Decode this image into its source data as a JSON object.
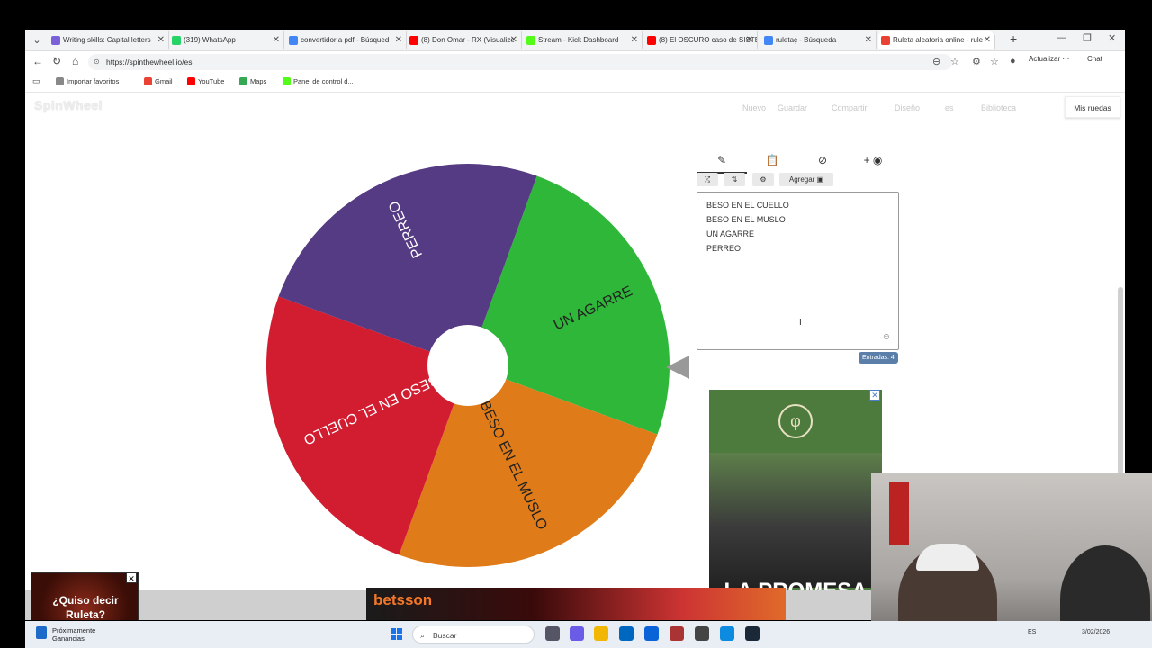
{
  "browser": {
    "tabs": [
      {
        "label": "Writing skills: Capital letters",
        "color": "#7b61d9"
      },
      {
        "label": "(319) WhatsApp",
        "color": "#25d366"
      },
      {
        "label": "convertidor a pdf - Búsqued",
        "color": "#4285f4"
      },
      {
        "label": "(8) Don Omar - RX (Visualize",
        "color": "#ff0000"
      },
      {
        "label": "Stream - Kick Dashboard",
        "color": "#53fc18"
      },
      {
        "label": "(8) El OSCURO caso de SISTE",
        "color": "#ff0000"
      },
      {
        "label": "ruletaç - Búsqueda",
        "color": "#4285f4"
      },
      {
        "label": "Ruleta aleatoria online - rule",
        "color": "#e94235"
      }
    ],
    "url": "https://spinthewheel.io/es",
    "update_label": "Actualizar",
    "chat_label": "Chat",
    "bookmarks": [
      {
        "label": "Importar favoritos",
        "color": "#888"
      },
      {
        "label": "Gmail",
        "color": "#ea4335"
      },
      {
        "label": "YouTube",
        "color": "#ff0000"
      },
      {
        "label": "Maps",
        "color": "#34a853"
      },
      {
        "label": "Panel de control d...",
        "color": "#53fc18"
      }
    ]
  },
  "site": {
    "logo": "SpinWheel",
    "menu": [
      "Nuevo",
      "Guardar",
      "Compartir",
      "Diseño",
      "es",
      "Biblioteca"
    ],
    "my_wheels": "Mis ruedas",
    "add_label": "Agregar",
    "entries": [
      "BESO EN EL CUELLO",
      "BESO EN EL MUSLO",
      "UN AGARRE",
      "PERREO"
    ],
    "entries_count": "Entradas: 4"
  },
  "wheel": {
    "segments": [
      {
        "label": "UN AGARRE",
        "color": "#2fb73a",
        "text_color": "#222"
      },
      {
        "label": "BESO EN EL MUSLO",
        "color": "#e07b1a",
        "text_color": "#222"
      },
      {
        "label": "BESO EN EL CUELLO",
        "color": "#d21c30",
        "text_color": "#ffffff"
      },
      {
        "label": "PERREO",
        "color": "#553a84",
        "text_color": "#ffffff"
      }
    ]
  },
  "ads": {
    "left_text_1": "¿Quiso decir",
    "left_text_2": "Ruleta?",
    "betsson": "betsson",
    "right_title": "LA PROMESA"
  },
  "taskbar": {
    "weather_title": "Próximamente",
    "weather_sub": "Ganancias",
    "search": "Buscar",
    "lang": "ES",
    "date": "3/02/2026"
  }
}
